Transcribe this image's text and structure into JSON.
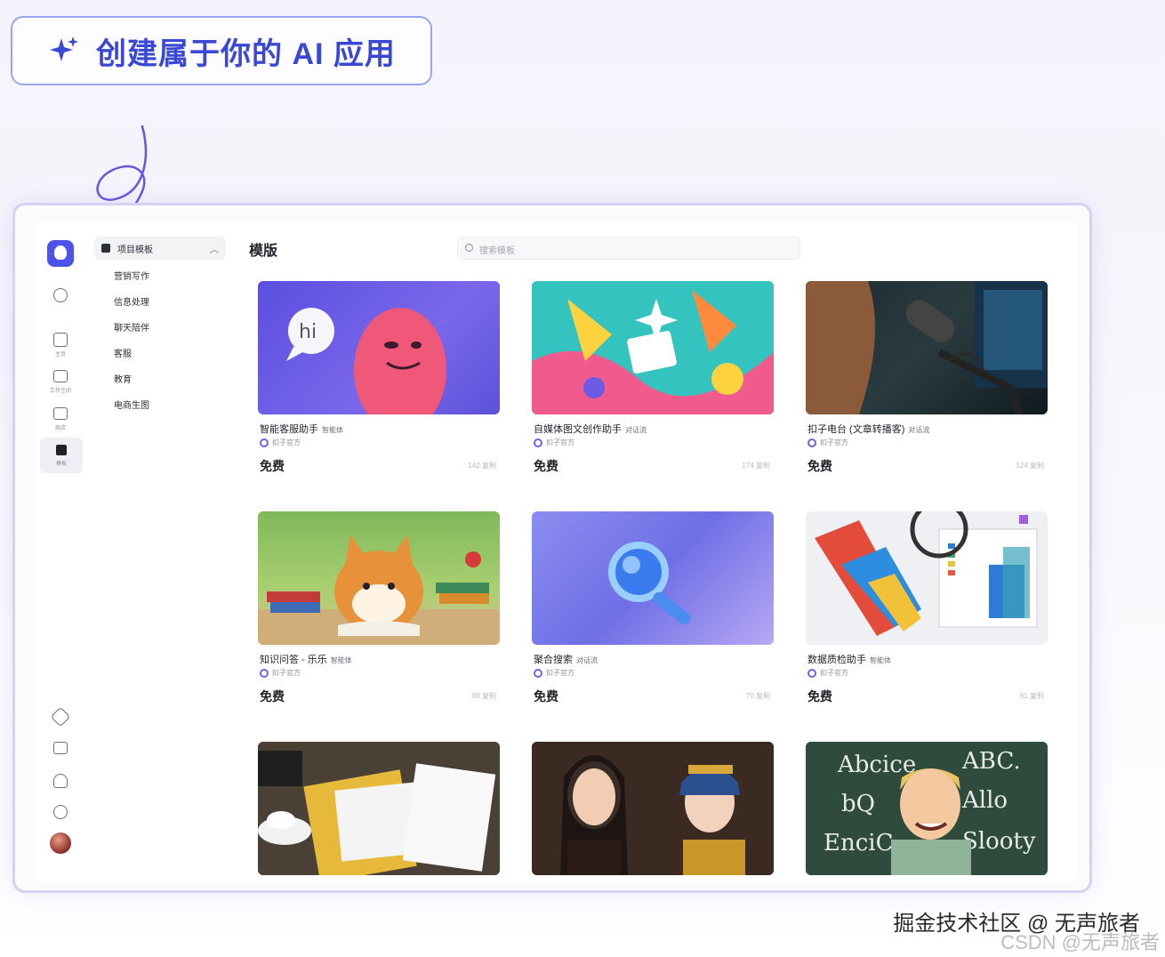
{
  "headline": {
    "text": "创建属于你的 AI 应用",
    "icon": "sparkle-icon"
  },
  "rail": {
    "items": [
      {
        "label": "主页",
        "icon": "home-icon"
      },
      {
        "label": "工作空间",
        "icon": "folder-icon"
      },
      {
        "label": "商店",
        "icon": "store-icon"
      },
      {
        "label": "模板",
        "icon": "template-icon"
      }
    ]
  },
  "categories": {
    "header": "项目模板",
    "items": [
      "营销写作",
      "信息处理",
      "聊天陪伴",
      "客服",
      "教育",
      "电商生图"
    ]
  },
  "main": {
    "title": "模版",
    "search_placeholder": "搜索模板",
    "cards": [
      {
        "name": "智能客服助手",
        "tag": "智能体",
        "author": "扣子官方",
        "price": "免费",
        "count": "142 复制"
      },
      {
        "name": "自媒体图文创作助手",
        "tag": "对话流",
        "author": "扣子官方",
        "price": "免费",
        "count": "174 复制"
      },
      {
        "name": "扣子电台 (文章转播客)",
        "tag": "对话流",
        "author": "扣子官方",
        "price": "免费",
        "count": "124 复制"
      },
      {
        "name": "知识问答 - 乐乐",
        "tag": "智能体",
        "author": "扣子官方",
        "price": "免费",
        "count": "98 复制"
      },
      {
        "name": "聚合搜索",
        "tag": "对话流",
        "author": "扣子官方",
        "price": "免费",
        "count": "70 复制"
      },
      {
        "name": "数据质检助手",
        "tag": "智能体",
        "author": "扣子官方",
        "price": "免费",
        "count": "61 复制"
      },
      {
        "name": "",
        "tag": "",
        "author": "",
        "price": "",
        "count": ""
      },
      {
        "name": "",
        "tag": "",
        "author": "",
        "price": "",
        "count": ""
      },
      {
        "name": "",
        "tag": "",
        "author": "",
        "price": "",
        "count": ""
      }
    ]
  },
  "watermark": {
    "line1": "掘金技术社区 @ 无声旅者",
    "line2": "CSDN @无声旅者"
  },
  "colors": {
    "accent": "#4d53e8",
    "headline": "#3a48d6",
    "frame": "#d4d2f4"
  }
}
